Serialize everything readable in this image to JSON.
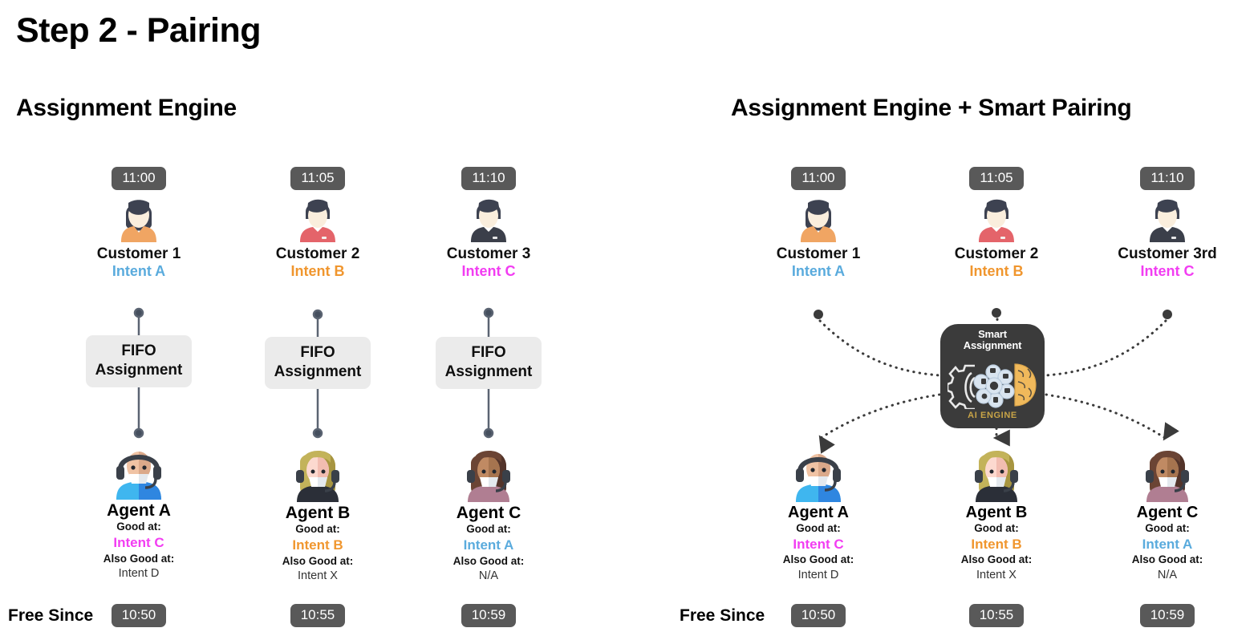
{
  "step_title": "Step 2 - Pairing",
  "panels": {
    "left": {
      "title": "Assignment Engine",
      "free_since_label": "Free Since",
      "columns": [
        {
          "time": "11:00",
          "customer_name": "Customer 1",
          "customer_intent": "Intent A",
          "customer_intent_color": "#5aabdd",
          "process_line1": "FIFO",
          "process_line2": "Assignment",
          "agent_name": "Agent A",
          "good_at_label": "Good at:",
          "good_at": "Intent C",
          "good_at_color": "#f23df2",
          "also_good_label": "Also Good at:",
          "also_good": "Intent D",
          "free_since": "10:50"
        },
        {
          "time": "11:05",
          "customer_name": "Customer 2",
          "customer_intent": "Intent B",
          "customer_intent_color": "#f0962e",
          "process_line1": "FIFO",
          "process_line2": "Assignment",
          "agent_name": "Agent B",
          "good_at_label": "Good at:",
          "good_at": "Intent B",
          "good_at_color": "#f0962e",
          "also_good_label": "Also Good at:",
          "also_good": "Intent X",
          "free_since": "10:55"
        },
        {
          "time": "11:10",
          "customer_name": "Customer 3",
          "customer_intent": "Intent C",
          "customer_intent_color": "#f23df2",
          "process_line1": "FIFO",
          "process_line2": "Assignment",
          "agent_name": "Agent C",
          "good_at_label": "Good at:",
          "good_at": "Intent A",
          "good_at_color": "#5aabdd",
          "also_good_label": "Also Good at:",
          "also_good": "N/A",
          "free_since": "10:59"
        }
      ]
    },
    "right": {
      "title": "Assignment Engine + Smart Pairing",
      "free_since_label": "Free Since",
      "engine": {
        "title_line1": "Smart",
        "title_line2": "Assignment",
        "footer": "AI ENGINE",
        "footer_color": "#c8a447",
        "icon": "gear-chip-brain-icon"
      },
      "columns": [
        {
          "time": "11:00",
          "customer_name": "Customer 1",
          "customer_intent": "Intent A",
          "customer_intent_color": "#5aabdd",
          "agent_name": "Agent A",
          "good_at_label": "Good at:",
          "good_at": "Intent C",
          "good_at_color": "#f23df2",
          "also_good_label": "Also Good at:",
          "also_good": "Intent D",
          "free_since": "10:50"
        },
        {
          "time": "11:05",
          "customer_name": "Customer 2",
          "customer_intent": "Intent B",
          "customer_intent_color": "#f0962e",
          "agent_name": "Agent B",
          "good_at_label": "Good at:",
          "good_at": "Intent B",
          "good_at_color": "#f0962e",
          "also_good_label": "Also Good at:",
          "also_good": "Intent X",
          "free_since": "10:55"
        },
        {
          "time": "11:10",
          "customer_name": "Customer 3rd",
          "customer_intent": "Intent C",
          "customer_intent_color": "#f23df2",
          "agent_name": "Agent C",
          "good_at_label": "Good at:",
          "good_at": "Intent A",
          "good_at_color": "#5aabdd",
          "also_good_label": "Also Good at:",
          "also_good": "N/A",
          "free_since": "10:59"
        }
      ]
    }
  }
}
